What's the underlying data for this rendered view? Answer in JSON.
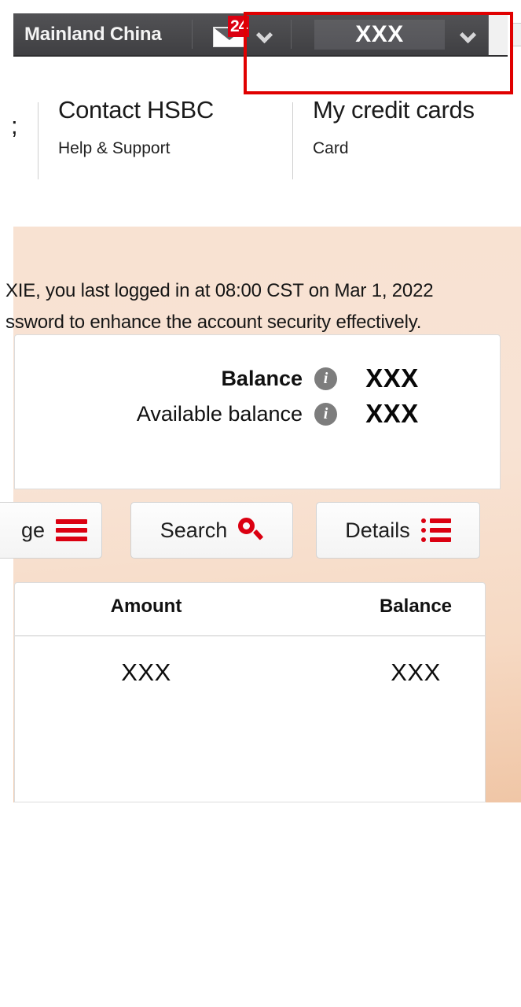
{
  "topbar": {
    "region_label": "Mainland China",
    "mail_icon": "envelope-icon",
    "mail_badge": "24",
    "mail_chevron": "chevron-down-icon",
    "account_value": "XXX",
    "account_chevron": "chevron-down-icon"
  },
  "annotation": {
    "type": "red-rectangle-highlight",
    "color": "#e00000"
  },
  "mainnav": {
    "clipped_item_text": ";",
    "items": [
      {
        "title": "Contact HSBC",
        "subtitle": "Help & Support"
      },
      {
        "title": "My credit cards",
        "subtitle": "Card"
      }
    ]
  },
  "banner": {
    "line1": "XIE, you last logged in at 08:00 CST on Mar 1, 2022",
    "line2": "ssword to enhance the account security effectively."
  },
  "balance_card": {
    "rows": [
      {
        "label": "Balance",
        "info_icon": "info-icon",
        "value": "XXX"
      },
      {
        "label": "Available balance",
        "info_icon": "info-icon",
        "value": "XXX"
      }
    ]
  },
  "actions": {
    "manage": {
      "label": "ge",
      "icon": "hamburger-menu-icon"
    },
    "search": {
      "label": "Search",
      "icon": "search-magnifier-icon"
    },
    "details": {
      "label": "Details",
      "icon": "list-details-icon"
    }
  },
  "transactions": {
    "columns": [
      "Amount",
      "Balance"
    ],
    "rows": [
      {
        "amount": "XXX",
        "balance": "XXX"
      }
    ]
  },
  "colors": {
    "brand_red": "#db0011",
    "topbar_gray": "#4b4b4e",
    "banner_peach": "#f8e2d2",
    "annotation_red": "#e00000",
    "info_icon_gray": "#7d7d7d"
  }
}
